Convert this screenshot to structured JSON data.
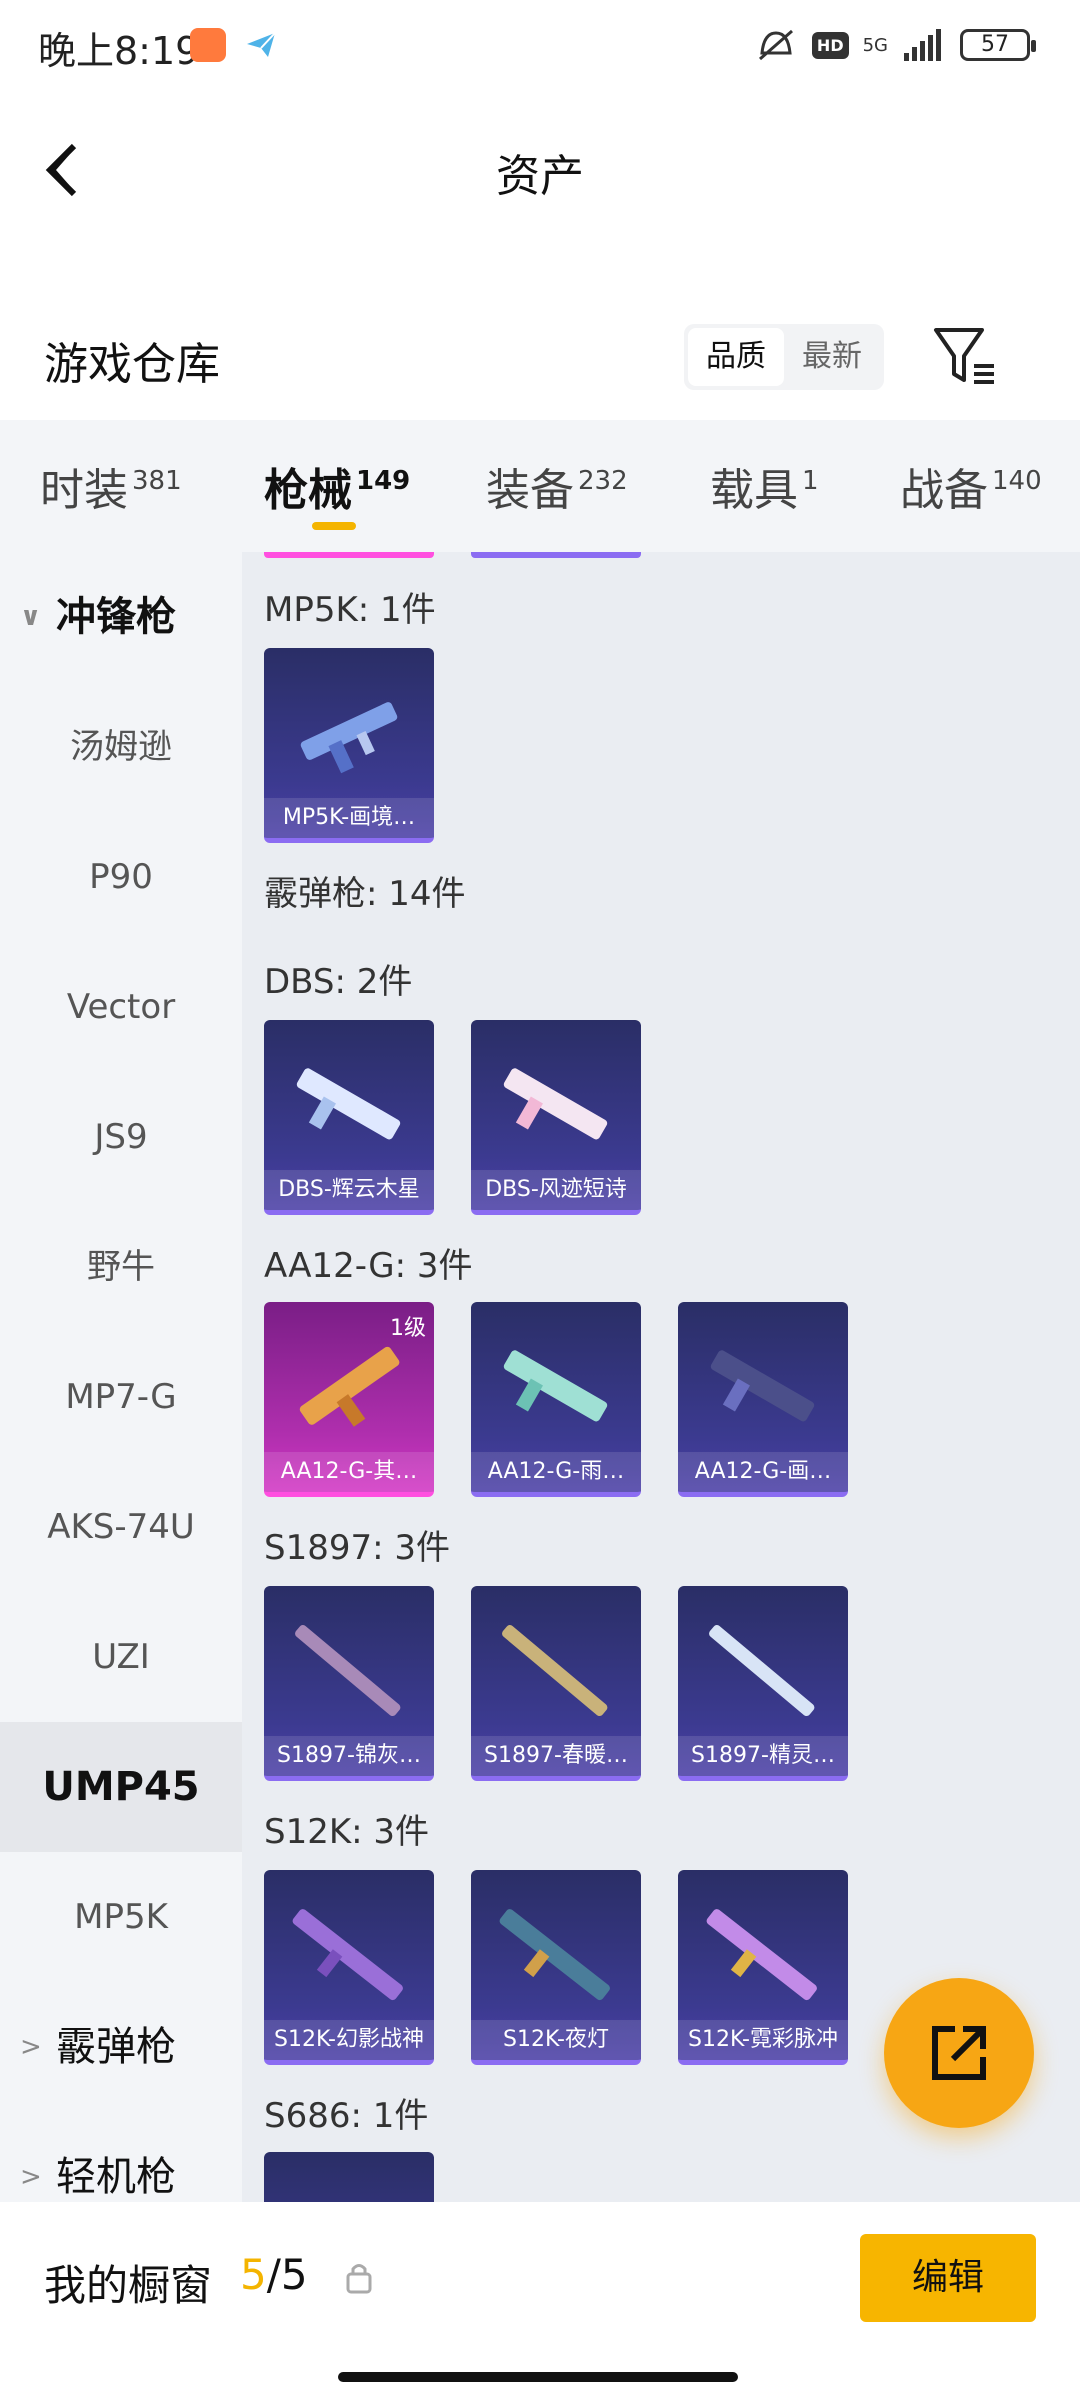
{
  "status_bar": {
    "time": "晚上8:19",
    "network": "5G",
    "hd": "HD",
    "battery": "57"
  },
  "header": {
    "title": "资产"
  },
  "warehouse": {
    "title": "游戏仓库",
    "sort_options": [
      "品质",
      "最新"
    ],
    "active_sort": "品质"
  },
  "tabs": [
    {
      "label": "时装",
      "count": "381"
    },
    {
      "label": "枪械",
      "count": "149",
      "active": true
    },
    {
      "label": "装备",
      "count": "232"
    },
    {
      "label": "载具",
      "count": "1"
    },
    {
      "label": "战备",
      "count": "140"
    }
  ],
  "sidebar": {
    "group_smg": "冲锋枪",
    "items": [
      "汤姆逊",
      "P90",
      "Vector",
      "JS9",
      "野牛",
      "MP7-G",
      "AKS-74U",
      "UZI",
      "UMP45",
      "MP5K"
    ],
    "selected": "UMP45",
    "group_shotgun": "霰弹枪",
    "group_lmg": "轻机枪"
  },
  "content": {
    "groups": [
      {
        "label": "MP5K: 1件",
        "cards": [
          {
            "name": "MP5K-画境…"
          }
        ]
      },
      {
        "label": "霰弹枪: 14件",
        "cards": []
      },
      {
        "label": "DBS: 2件",
        "cards": [
          {
            "name": "DBS-辉云木星"
          },
          {
            "name": "DBS-风迹短诗"
          }
        ]
      },
      {
        "label": "AA12-G: 3件",
        "cards": [
          {
            "name": "AA12-G-其…",
            "level": "1级",
            "rarity": "pink"
          },
          {
            "name": "AA12-G-雨…"
          },
          {
            "name": "AA12-G-画…"
          }
        ]
      },
      {
        "label": "S1897: 3件",
        "cards": [
          {
            "name": "S1897-锦灰…"
          },
          {
            "name": "S1897-春暖…"
          },
          {
            "name": "S1897-精灵…"
          }
        ]
      },
      {
        "label": "S12K: 3件",
        "cards": [
          {
            "name": "S12K-幻影战神"
          },
          {
            "name": "S12K-夜灯"
          },
          {
            "name": "S12K-霓彩脉冲"
          }
        ]
      },
      {
        "label": "S686: 1件",
        "cards": []
      }
    ]
  },
  "bottom_bar": {
    "label": "我的橱窗",
    "current": "5",
    "sep_total": "/5",
    "edit_label": "编辑"
  },
  "colors": {
    "accent": "#f7b500",
    "card_epic": "#3b3a8f",
    "card_legend": "#b02fae"
  }
}
